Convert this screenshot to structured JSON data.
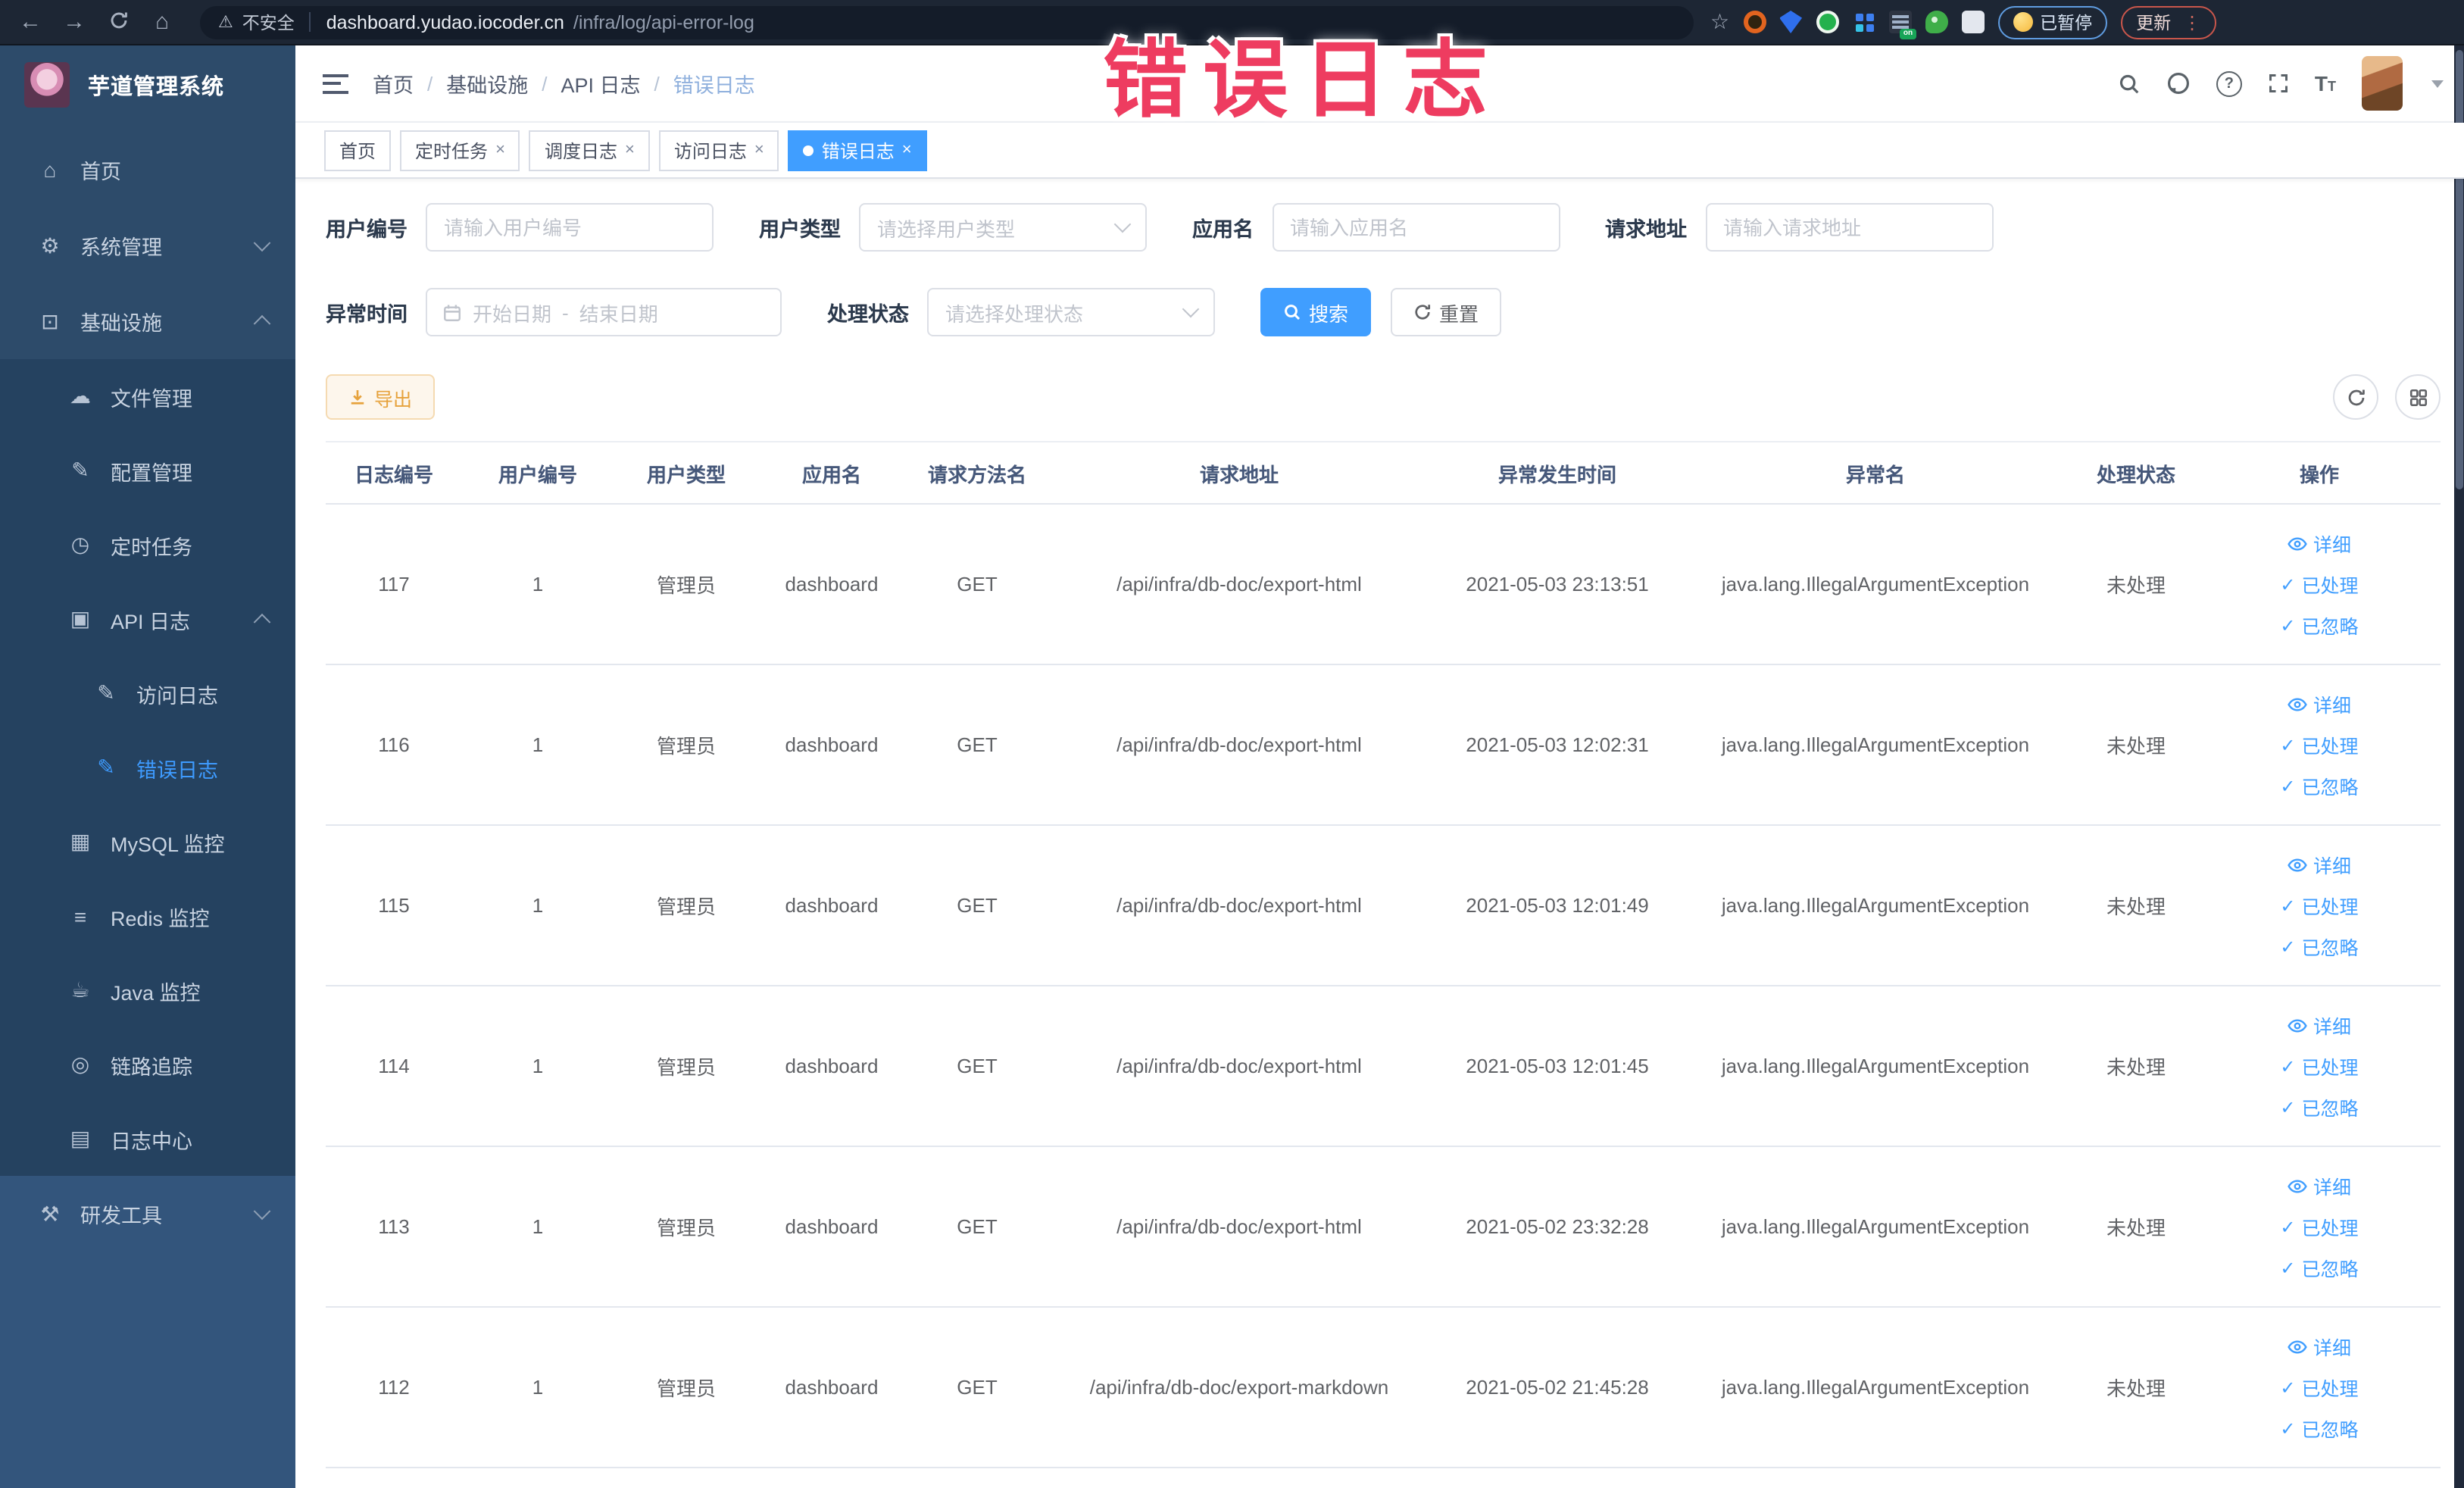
{
  "annotation": {
    "text": "错误日志"
  },
  "colors": {
    "accent": "#409eff",
    "warning": "#e6a23c",
    "annotation_red": "#ee3c60",
    "sidebar_bg": "#2d4b6a"
  },
  "browser": {
    "security_label": "不安全",
    "url_host": "dashboard.yudao.iocoder.cn",
    "url_path": "/infra/log/api-error-log",
    "paused_badge": "已暂停",
    "update_button": "更新"
  },
  "icons": {
    "back-icon": "←",
    "forward-icon": "→",
    "home-icon": "⌂",
    "warning-icon": "⚠",
    "star-icon": "☆",
    "menu-home-icon": "⌂",
    "gear-icon": "⚙",
    "infra-icon": "⊡",
    "file-icon": "☁",
    "config-icon": "✎",
    "job-icon": "◷",
    "api-log-icon": "▣",
    "access-log-icon": "✎",
    "error-log-icon": "✎",
    "mysql-icon": "▦",
    "redis-icon": "≡",
    "java-icon": "☕",
    "trace-icon": "◎",
    "log-center-icon": "▤",
    "tools-icon": "⚒",
    "vdots-icon": "⋮"
  },
  "sidebar": {
    "title": "芋道管理系统",
    "items": [
      {
        "label": "首页",
        "icon": "menu-home-icon",
        "level": 0
      },
      {
        "label": "系统管理",
        "icon": "gear-icon",
        "level": 0,
        "chevron": "down"
      },
      {
        "label": "基础设施",
        "icon": "infra-icon",
        "level": 0,
        "chevron": "up"
      },
      {
        "label": "文件管理",
        "icon": "file-icon",
        "level": 1,
        "dark": true
      },
      {
        "label": "配置管理",
        "icon": "config-icon",
        "level": 1,
        "dark": true
      },
      {
        "label": "定时任务",
        "icon": "job-icon",
        "level": 1,
        "dark": true
      },
      {
        "label": "API 日志",
        "icon": "api-log-icon",
        "level": 1,
        "dark": true,
        "chevron": "up"
      },
      {
        "label": "访问日志",
        "icon": "access-log-icon",
        "level": 2,
        "dark": true
      },
      {
        "label": "错误日志",
        "icon": "error-log-icon",
        "level": 2,
        "dark": true,
        "active": true
      },
      {
        "label": "MySQL 监控",
        "icon": "mysql-icon",
        "level": 1,
        "dark": true
      },
      {
        "label": "Redis 监控",
        "icon": "redis-icon",
        "level": 1,
        "dark": true
      },
      {
        "label": "Java 监控",
        "icon": "java-icon",
        "level": 1,
        "dark": true
      },
      {
        "label": "链路追踪",
        "icon": "trace-icon",
        "level": 1,
        "dark": true
      },
      {
        "label": "日志中心",
        "icon": "log-center-icon",
        "level": 1,
        "dark": true
      },
      {
        "label": "研发工具",
        "icon": "tools-icon",
        "level": 0,
        "light": true,
        "chevron": "down"
      }
    ]
  },
  "header": {
    "breadcrumb": [
      "首页",
      "基础设施",
      "API 日志",
      "错误日志"
    ]
  },
  "tabs": {
    "items": [
      {
        "label": "首页",
        "closable": false,
        "active": false
      },
      {
        "label": "定时任务",
        "closable": true,
        "active": false
      },
      {
        "label": "调度日志",
        "closable": true,
        "active": false
      },
      {
        "label": "访问日志",
        "closable": true,
        "active": false
      },
      {
        "label": "错误日志",
        "closable": true,
        "active": true
      }
    ]
  },
  "filters": {
    "user_id": {
      "label": "用户编号",
      "placeholder": "请输入用户编号"
    },
    "user_type": {
      "label": "用户类型",
      "placeholder": "请选择用户类型"
    },
    "app_name": {
      "label": "应用名",
      "placeholder": "请输入应用名"
    },
    "request_url": {
      "label": "请求地址",
      "placeholder": "请输入请求地址"
    },
    "exception_time": {
      "label": "异常时间",
      "start_placeholder": "开始日期",
      "separator": "-",
      "end_placeholder": "结束日期"
    },
    "process_status": {
      "label": "处理状态",
      "placeholder": "请选择处理状态"
    },
    "search_button": "搜索",
    "reset_button": "重置"
  },
  "toolbar": {
    "export_button": "导出"
  },
  "table": {
    "columns": [
      "日志编号",
      "用户编号",
      "用户类型",
      "应用名",
      "请求方法名",
      "请求地址",
      "异常发生时间",
      "异常名",
      "处理状态",
      "操作"
    ],
    "action_labels": {
      "detail": "详细",
      "processed": "已处理",
      "ignored": "已忽略"
    },
    "rows": [
      {
        "log_id": "117",
        "user_id": "1",
        "user_type": "管理员",
        "app_name": "dashboard",
        "method": "GET",
        "url": "/api/infra/db-doc/export-html",
        "time": "2021-05-03 23:13:51",
        "exception": "java.lang.IllegalArgumentException",
        "status": "未处理"
      },
      {
        "log_id": "116",
        "user_id": "1",
        "user_type": "管理员",
        "app_name": "dashboard",
        "method": "GET",
        "url": "/api/infra/db-doc/export-html",
        "time": "2021-05-03 12:02:31",
        "exception": "java.lang.IllegalArgumentException",
        "status": "未处理"
      },
      {
        "log_id": "115",
        "user_id": "1",
        "user_type": "管理员",
        "app_name": "dashboard",
        "method": "GET",
        "url": "/api/infra/db-doc/export-html",
        "time": "2021-05-03 12:01:49",
        "exception": "java.lang.IllegalArgumentException",
        "status": "未处理"
      },
      {
        "log_id": "114",
        "user_id": "1",
        "user_type": "管理员",
        "app_name": "dashboard",
        "method": "GET",
        "url": "/api/infra/db-doc/export-html",
        "time": "2021-05-03 12:01:45",
        "exception": "java.lang.IllegalArgumentException",
        "status": "未处理"
      },
      {
        "log_id": "113",
        "user_id": "1",
        "user_type": "管理员",
        "app_name": "dashboard",
        "method": "GET",
        "url": "/api/infra/db-doc/export-html",
        "time": "2021-05-02 23:32:28",
        "exception": "java.lang.IllegalArgumentException",
        "status": "未处理"
      },
      {
        "log_id": "112",
        "user_id": "1",
        "user_type": "管理员",
        "app_name": "dashboard",
        "method": "GET",
        "url": "/api/infra/db-doc/export-markdown",
        "time": "2021-05-02 21:45:28",
        "exception": "java.lang.IllegalArgumentException",
        "status": "未处理"
      }
    ]
  }
}
